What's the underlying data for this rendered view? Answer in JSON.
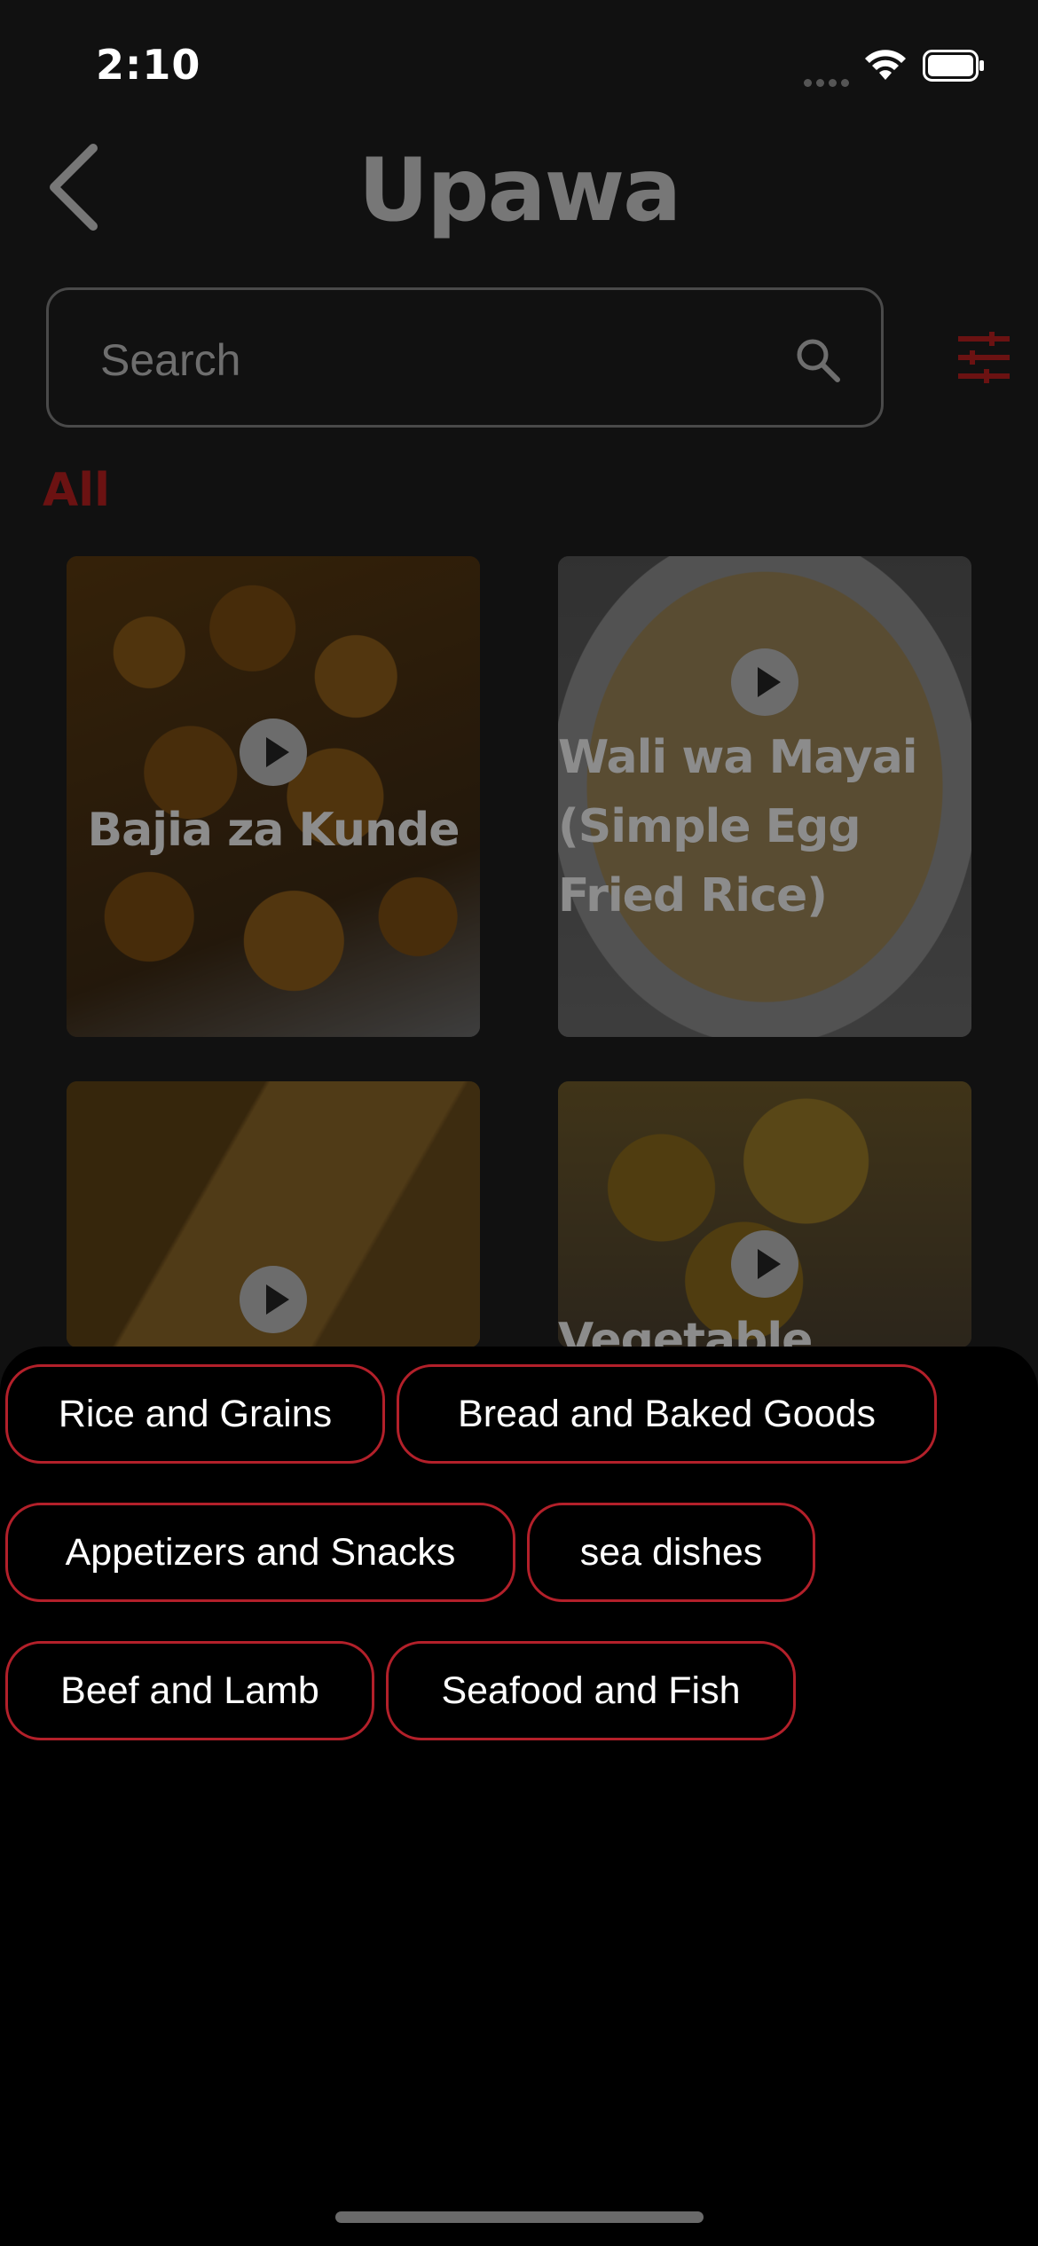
{
  "status_bar": {
    "time": "2:10"
  },
  "header": {
    "title": "Upawa"
  },
  "search": {
    "placeholder": "Search"
  },
  "tabs": {
    "active": "All"
  },
  "recipes": [
    {
      "title": "Bajia za Kunde"
    },
    {
      "title": "Wali wa Mayai (Simple Egg Fried Rice)"
    },
    {
      "title": ""
    },
    {
      "title": "Vegetable Spring"
    }
  ],
  "categories": [
    "Rice and Grains",
    "Bread and Baked Goods",
    "Appetizers and Snacks",
    "sea dishes",
    "Beef and Lamb",
    "Seafood and Fish"
  ],
  "colors": {
    "accent": "#b3202a",
    "tab_active": "#6b1212",
    "background": "#111111",
    "sheet": "#000000"
  },
  "icons": [
    "back-chevron-icon",
    "search-icon",
    "filter-sliders-icon",
    "play-icon",
    "wifi-icon",
    "battery-icon"
  ]
}
